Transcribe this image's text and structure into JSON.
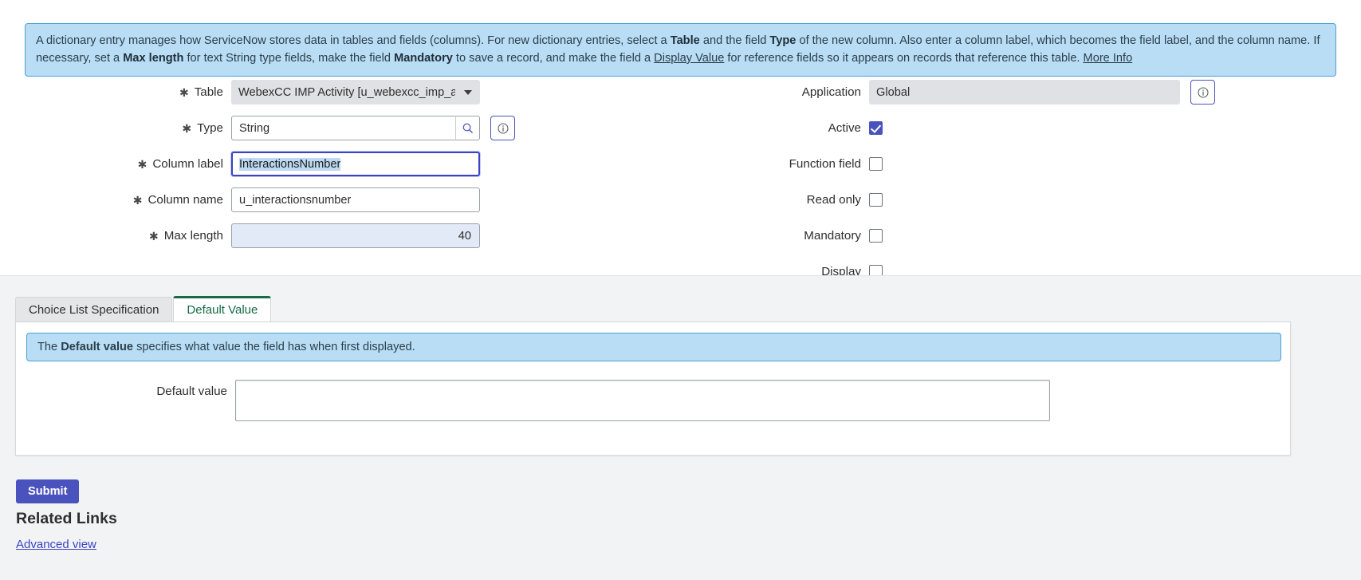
{
  "banner": {
    "parts": [
      {
        "t": "A dictionary entry manages how ServiceNow stores data in tables and fields (columns). For new dictionary entries, select a ",
        "s": "n"
      },
      {
        "t": "Table",
        "s": "b"
      },
      {
        "t": " and the field ",
        "s": "n"
      },
      {
        "t": "Type",
        "s": "b"
      },
      {
        "t": " of the new column. Also enter a column label, which becomes the field label, and the column name. If necessary, set a ",
        "s": "n"
      },
      {
        "t": "Max length",
        "s": "b"
      },
      {
        "t": " for text String type fields, make the field ",
        "s": "n"
      },
      {
        "t": "Mandatory",
        "s": "b"
      },
      {
        "t": " to save a record, and make the field a ",
        "s": "n"
      },
      {
        "t": "Display Value",
        "s": "u"
      },
      {
        "t": " for reference fields so it appears on records that reference this table. ",
        "s": "n"
      },
      {
        "t": "More Info",
        "s": "u"
      }
    ]
  },
  "form": {
    "left": {
      "table": {
        "label": "Table",
        "required": true,
        "value": "WebexCC IMP Activity [u_webexcc_imp_act...",
        "control": "select"
      },
      "type": {
        "label": "Type",
        "required": true,
        "value": "String",
        "control": "lookup",
        "lookup_icon": "search-icon",
        "info_icon": "info-icon"
      },
      "column_label": {
        "label": "Column label",
        "required": true,
        "value": "InteractionsNumber",
        "control": "text",
        "focused": true,
        "selected": true
      },
      "column_name": {
        "label": "Column name",
        "required": true,
        "value": "u_interactionsnumber",
        "control": "text"
      },
      "max_length": {
        "label": "Max length",
        "required": true,
        "value": "40",
        "control": "text",
        "readonly_style": true
      }
    },
    "right": {
      "application": {
        "label": "Application",
        "value": "Global",
        "control": "readonly",
        "info_icon": "info-icon"
      },
      "active": {
        "label": "Active",
        "checked": true
      },
      "function_field": {
        "label": "Function field",
        "checked": false
      },
      "read_only": {
        "label": "Read only",
        "checked": false
      },
      "mandatory": {
        "label": "Mandatory",
        "checked": false
      },
      "display": {
        "label": "Display",
        "checked": false
      }
    }
  },
  "section": {
    "tabs": [
      {
        "label": "Choice List Specification",
        "active": false
      },
      {
        "label": "Default Value",
        "active": true
      }
    ],
    "note": [
      {
        "t": "The ",
        "s": "n"
      },
      {
        "t": "Default value",
        "s": "b"
      },
      {
        "t": " specifies what value the field has when first displayed.",
        "s": "n"
      }
    ],
    "default_value": {
      "label": "Default value",
      "value": "",
      "placeholder": ""
    }
  },
  "actions": {
    "submit_label": "Submit",
    "related_links_title": "Related Links",
    "advanced_view_label": "Advanced view"
  },
  "colors": {
    "accent": "#4a53bd",
    "banner_bg": "#b8ddf5",
    "banner_border": "#4f9fcf",
    "tab_active_underline": "#186b44",
    "selection": "#bcd9f1"
  }
}
